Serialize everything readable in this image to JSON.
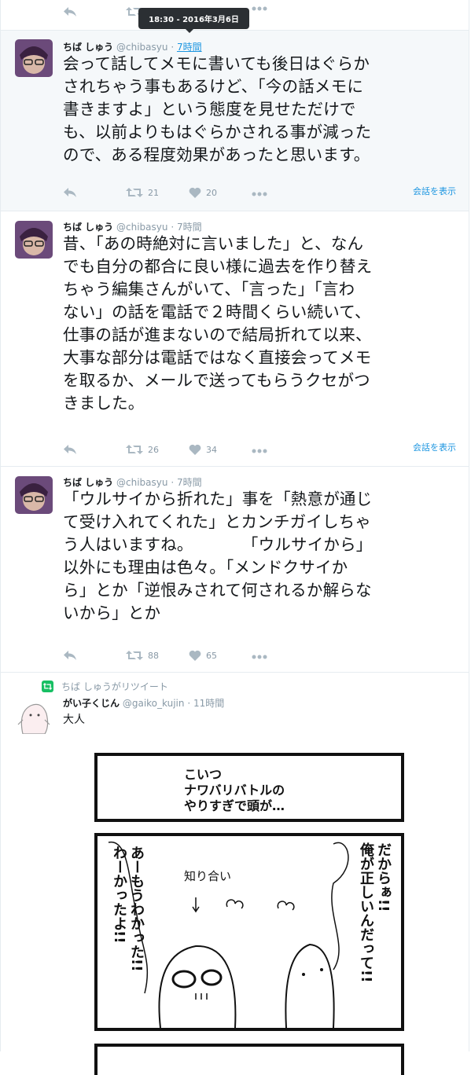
{
  "tooltip": "18:30 - 2016年3月6日",
  "colors": {
    "accent": "#1b95e0",
    "muted": "#8899a6",
    "retweet_green": "#17bf63"
  },
  "conversation_label": "会話を表示",
  "tweets": [
    {
      "name": "ちば しゅう",
      "handle": "@chibasyu",
      "dot": "·",
      "time": "7時間",
      "lines": [
        "会って話してメモに書いても後日はぐらか",
        "されちゃう事もあるけど、「今の話メモに",
        "書きますよ」という態度を見せただけで",
        "も、以前よりもはぐらかされる事が減った",
        "ので、ある程度効果があったと思います。"
      ],
      "retweets": "21",
      "likes": "20"
    },
    {
      "name": "ちば しゅう",
      "handle": "@chibasyu",
      "dot": "·",
      "time": "7時間",
      "lines": [
        "昔、「あの時絶対に言いました」と、なん",
        "でも自分の都合に良い様に過去を作り替え",
        "ちゃう編集さんがいて、「言った」「言わ",
        "ない」の話を電話で２時間くらい続いて、",
        "仕事の話が進まないので結局折れて以来、",
        "大事な部分は電話ではなく直接会ってメモ",
        "を取るか、メールで送ってもらうクセがつ",
        "きました。"
      ],
      "retweets": "26",
      "likes": "34"
    },
    {
      "name": "ちば しゅう",
      "handle": "@chibasyu",
      "dot": "·",
      "time": "7時間",
      "lines": [
        "「ウルサイから折れた」事を「熱意が通じ",
        "て受け入れてくれた」とカンチガイしちゃ",
        "う人はいますね。　　　　「ウルサイから」",
        "以外にも理由は色々。「メンドクサイか",
        "ら」とか「逆恨みされて何されるか解らな",
        "いから」とか"
      ],
      "retweets": "88",
      "likes": "65"
    }
  ],
  "retweet_context": "ちば しゅうがリツイート",
  "rt_tweet": {
    "name": "がい子くじん",
    "handle": "@gaiko_kujin",
    "dot": "·",
    "time": "11時間",
    "text": "大人"
  },
  "comic": {
    "panel1_lines": [
      "こいつ",
      "ナワバリバトルの",
      "やりすぎで頭が…"
    ],
    "left_col1": "あーもうわかった!!",
    "left_col2": "わーかったよ!!",
    "right_col1": "だからぁ!!",
    "right_col2": "俺が正しいんだって!!",
    "label": "知り合い"
  }
}
